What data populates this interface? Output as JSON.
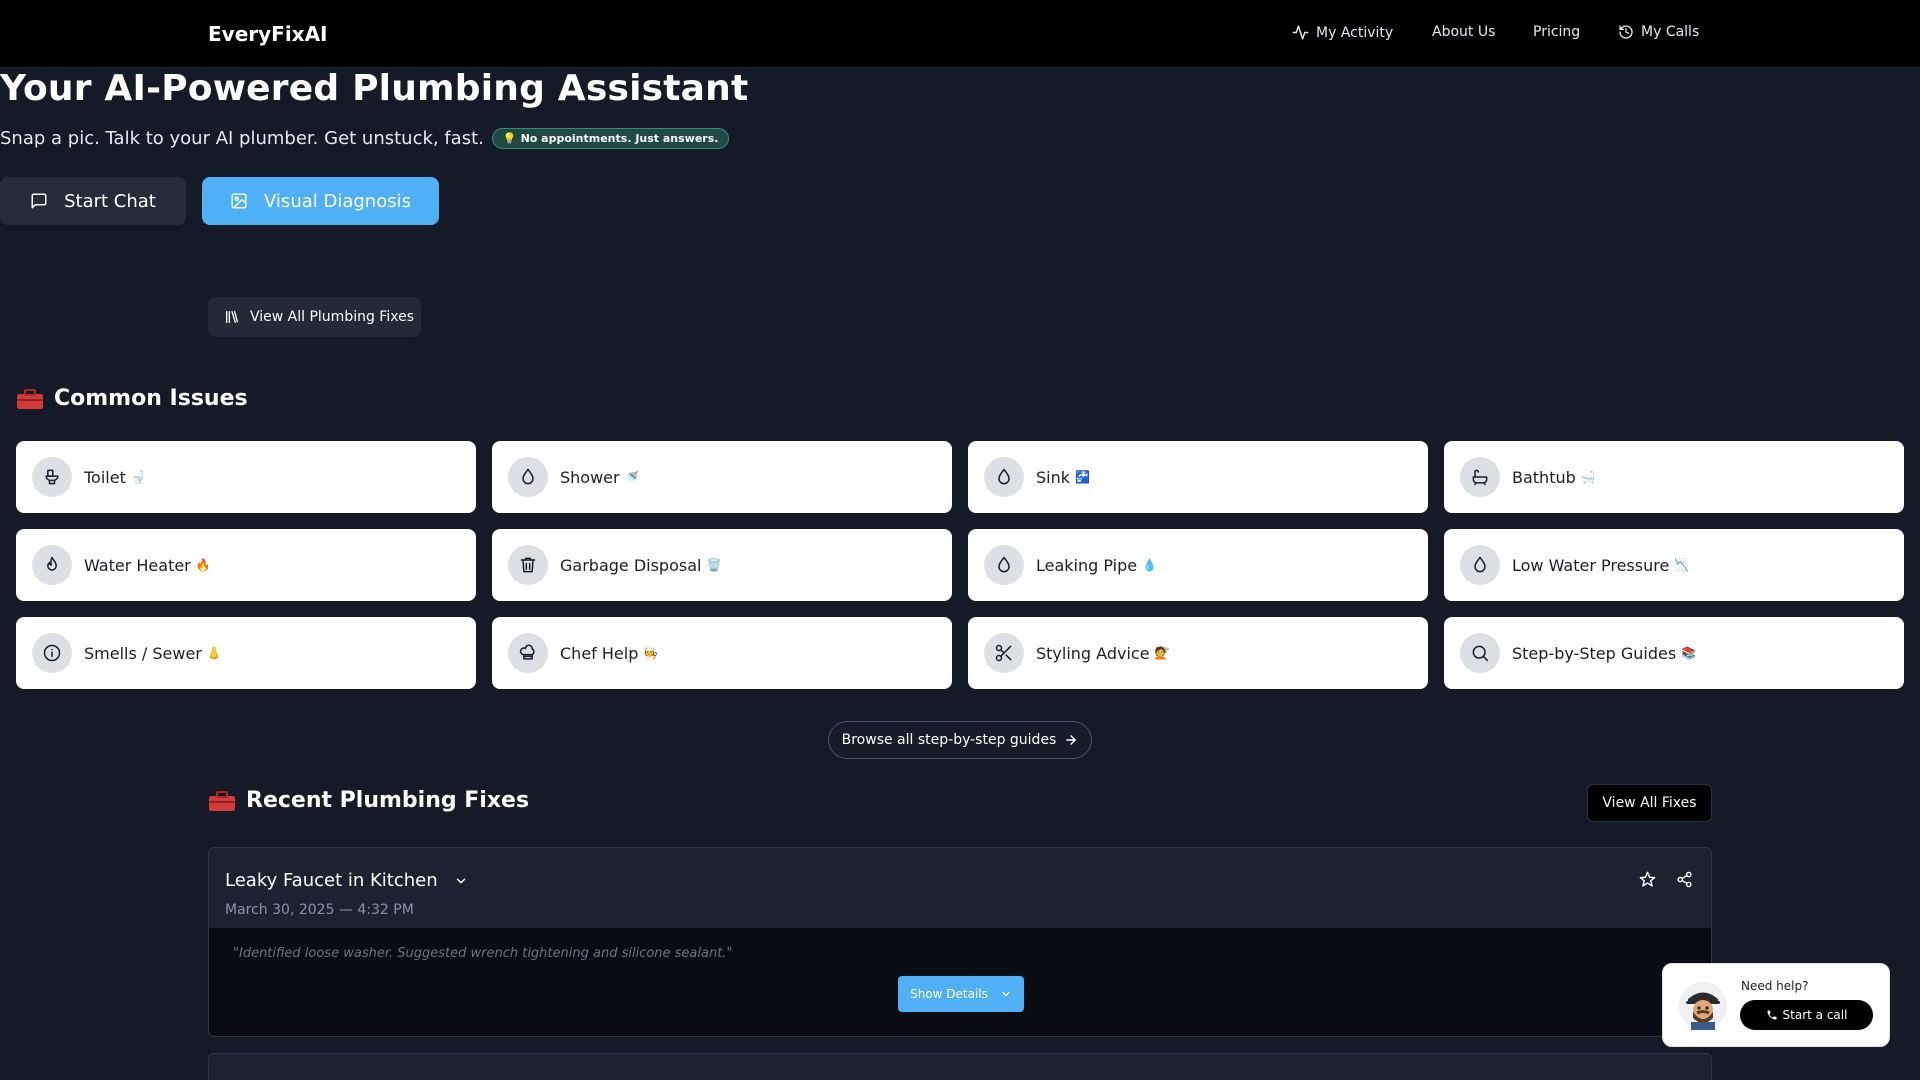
{
  "nav": {
    "brand": "EveryFixAI",
    "links": [
      {
        "label": "My Activity",
        "icon": "activity-icon"
      },
      {
        "label": "About Us"
      },
      {
        "label": "Pricing"
      },
      {
        "label": "My Calls",
        "icon": "history-icon"
      }
    ]
  },
  "hero": {
    "title": "Your AI-Powered Plumbing Assistant",
    "subtitle": "Snap a pic. Talk to your AI plumber. Get unstuck, fast.",
    "badge_emoji": "💡",
    "badge": "No appointments. Just answers.",
    "start_chat": "Start Chat",
    "visual_diagnosis": "Visual Diagnosis",
    "view_all": "View All Plumbing Fixes"
  },
  "common": {
    "title": "Common Issues",
    "items": [
      {
        "label": "Toilet",
        "emoji": "🚽",
        "icon": "toilet-icon"
      },
      {
        "label": "Shower",
        "emoji": "🚿",
        "icon": "droplet-icon"
      },
      {
        "label": "Sink",
        "emoji": "🚰",
        "icon": "droplet-icon"
      },
      {
        "label": "Bathtub",
        "emoji": "🛁",
        "icon": "bath-icon"
      },
      {
        "label": "Water Heater",
        "emoji": "🔥",
        "icon": "flame-icon"
      },
      {
        "label": "Garbage Disposal",
        "emoji": "🗑️",
        "icon": "trash-icon"
      },
      {
        "label": "Leaking Pipe",
        "emoji": "💧",
        "icon": "droplet-icon"
      },
      {
        "label": "Low Water Pressure",
        "emoji": "📉",
        "icon": "droplet-icon"
      },
      {
        "label": "Smells / Sewer",
        "emoji": "👃",
        "icon": "info-icon"
      },
      {
        "label": "Chef Help",
        "emoji": "🧑‍🍳",
        "icon": "chef-hat-icon"
      },
      {
        "label": "Styling Advice",
        "emoji": "💇",
        "icon": "scissors-icon"
      },
      {
        "label": "Step-by-Step Guides",
        "emoji": "📚",
        "icon": "search-icon"
      }
    ],
    "browse": "Browse all step-by-step guides"
  },
  "recent": {
    "title": "Recent Plumbing Fixes",
    "view_all": "View All Fixes",
    "fixes": [
      {
        "title": "Leaky Faucet in Kitchen",
        "date": "March 30, 2025 — 4:32 PM",
        "note": "\"Identified loose washer. Suggested wrench tightening and silicone sealant.\"",
        "show_details": "Show Details"
      }
    ]
  },
  "help": {
    "prompt": "Need help?",
    "call": "Start a call"
  },
  "colors": {
    "background": "#141a26",
    "navbar": "#000000",
    "accent": "#4fb0f5",
    "card": "#ffffff"
  }
}
